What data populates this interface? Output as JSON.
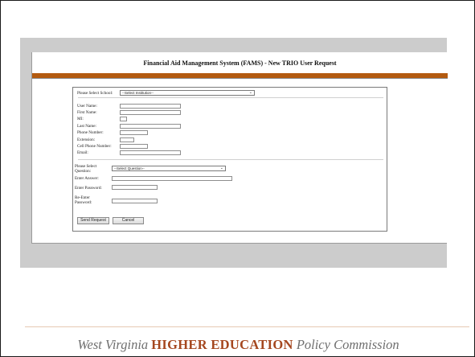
{
  "app": {
    "title": "Financial Aid Management System (FAMS) - New TRIO User Request",
    "accent_color": "#b35a10"
  },
  "school": {
    "label": "Please Select School:",
    "selected": "--Select Institution--"
  },
  "user_fields": [
    {
      "label": "User Name:",
      "value": ""
    },
    {
      "label": "First Name:",
      "value": ""
    },
    {
      "label": "MI:",
      "value": ""
    },
    {
      "label": "Last Name:",
      "value": ""
    },
    {
      "label": "Phone Number:",
      "value": ""
    },
    {
      "label": "Extension:",
      "value": ""
    },
    {
      "label": "Cell Phone Number:",
      "value": ""
    },
    {
      "label": "Email:",
      "value": ""
    }
  ],
  "security": {
    "question_label": "Please Select Question:",
    "question_selected": "--Select Question--",
    "answer_label": "Enter Answer:",
    "password_label": "Enter Password:",
    "reenter_label": "Re-Enter Password:"
  },
  "buttons": {
    "send": "Send Request",
    "cancel": "Cancel"
  },
  "footer": {
    "prefix": "West Virginia",
    "highlight": "HIGHER EDUCATION",
    "suffix": "Policy Commission",
    "highlight_color": "#a5471f"
  }
}
